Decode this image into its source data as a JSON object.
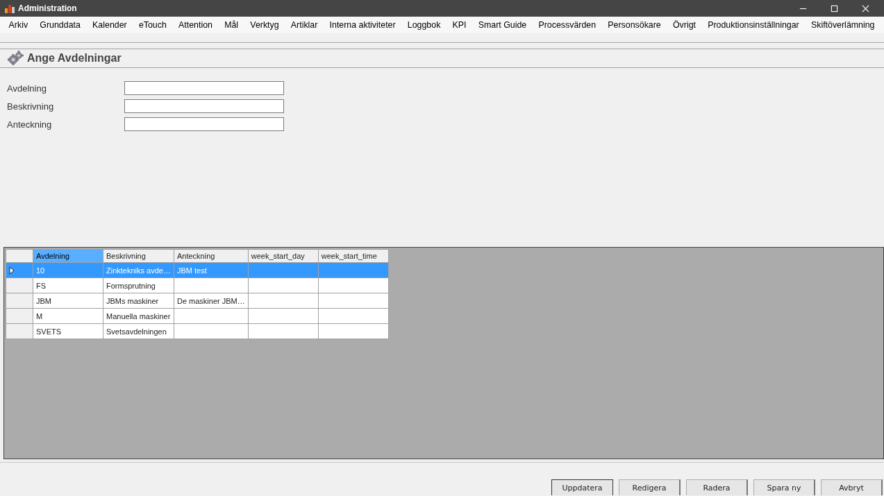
{
  "window": {
    "title": "Administration"
  },
  "menu": [
    "Arkiv",
    "Grunddata",
    "Kalender",
    "eTouch",
    "Attention",
    "Mål",
    "Verktyg",
    "Artiklar",
    "Interna aktiviteter",
    "Loggbok",
    "KPI",
    "Smart Guide",
    "Processvärden",
    "Personsökare",
    "Övrigt",
    "Produktionsinställningar",
    "Skiftöverlämning"
  ],
  "panel": {
    "title": "Ange Avdelningar"
  },
  "form": [
    {
      "label": "Avdelning"
    },
    {
      "label": "Beskrivning"
    },
    {
      "label": "Anteckning"
    }
  ],
  "grid": {
    "columns": [
      {
        "label": "Avdelning",
        "selected": true
      },
      {
        "label": "Beskrivning",
        "selected": false
      },
      {
        "label": "Anteckning",
        "selected": false
      },
      {
        "label": "week_start_day",
        "selected": false
      },
      {
        "label": "week_start_time",
        "selected": false
      }
    ],
    "rows": [
      {
        "selected": true,
        "cells": [
          "10",
          "Zinktekniks avde…",
          "JBM test",
          "",
          ""
        ]
      },
      {
        "selected": false,
        "cells": [
          "FS",
          "Formsprutning",
          "",
          "",
          ""
        ]
      },
      {
        "selected": false,
        "cells": [
          "JBM",
          "JBMs maskiner",
          "De maskiner JBM…",
          "",
          ""
        ]
      },
      {
        "selected": false,
        "cells": [
          "M",
          "Manuella maskiner",
          "",
          "",
          ""
        ]
      },
      {
        "selected": false,
        "cells": [
          "SVETS",
          "Svetsavdelningen",
          "",
          "",
          ""
        ]
      }
    ]
  },
  "buttons": [
    {
      "label": "Uppdatera",
      "default": true
    },
    {
      "label": "Redigera",
      "default": false
    },
    {
      "label": "Radera",
      "default": false
    },
    {
      "label": "Spara ny",
      "default": false
    },
    {
      "label": "Avbryt",
      "default": false
    }
  ]
}
